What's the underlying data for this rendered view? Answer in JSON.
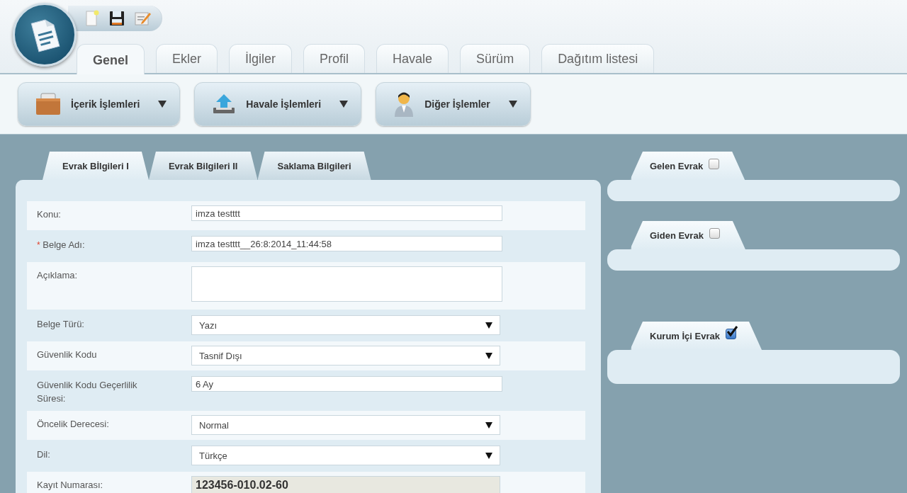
{
  "main_tabs": [
    {
      "label": "Genel",
      "selected": true
    },
    {
      "label": "Ekler",
      "selected": false
    },
    {
      "label": "İlgiler",
      "selected": false
    },
    {
      "label": "Profil",
      "selected": false
    },
    {
      "label": "Havale",
      "selected": false
    },
    {
      "label": "Sürüm",
      "selected": false
    },
    {
      "label": "Dağıtım listesi",
      "selected": false
    }
  ],
  "toolbar": [
    {
      "label": "İçerik İşlemleri",
      "kind": "briefcase"
    },
    {
      "label": "Havale İşlemleri",
      "kind": "upload"
    },
    {
      "label": "Diğer İşlemler",
      "kind": "person"
    }
  ],
  "form_tabs": [
    {
      "label": "Evrak Bİlgileri I",
      "selected": true
    },
    {
      "label": "Evrak Bilgileri II",
      "selected": false
    },
    {
      "label": "Saklama Bilgileri",
      "selected": false
    }
  ],
  "fields": [
    {
      "label": "Konu:",
      "kind": "text",
      "value": "imza testttt"
    },
    {
      "marker": "*",
      "label": "Belge Adı:",
      "kind": "text",
      "value": "imza testttt__26:8:2014_11:44:58"
    },
    {
      "label": "Açıklama:",
      "kind": "textarea"
    },
    {
      "label": "Belge Türü:",
      "kind": "select",
      "value": "Yazı"
    },
    {
      "label": "Güvenlik Kodu",
      "kind": "select",
      "value": "Tasnif Dışı"
    },
    {
      "label": "Güvenlik Kodu Geçerlilik Süresi:",
      "kind": "text",
      "value": "6 Ay"
    },
    {
      "label": "Öncelik Derecesi:",
      "kind": "select",
      "value": "Normal"
    },
    {
      "label": "Dil:",
      "kind": "select",
      "value": "Türkçe"
    },
    {
      "label": "Kayıt Numarası:",
      "kind": "readonly",
      "value": "123456-010.02-60"
    }
  ],
  "side_groups": [
    {
      "label": "Gelen Evrak",
      "checked": false
    },
    {
      "label": "Giden Evrak",
      "checked": false
    },
    {
      "label": "Kurum İçi Evrak",
      "checked": true
    }
  ]
}
